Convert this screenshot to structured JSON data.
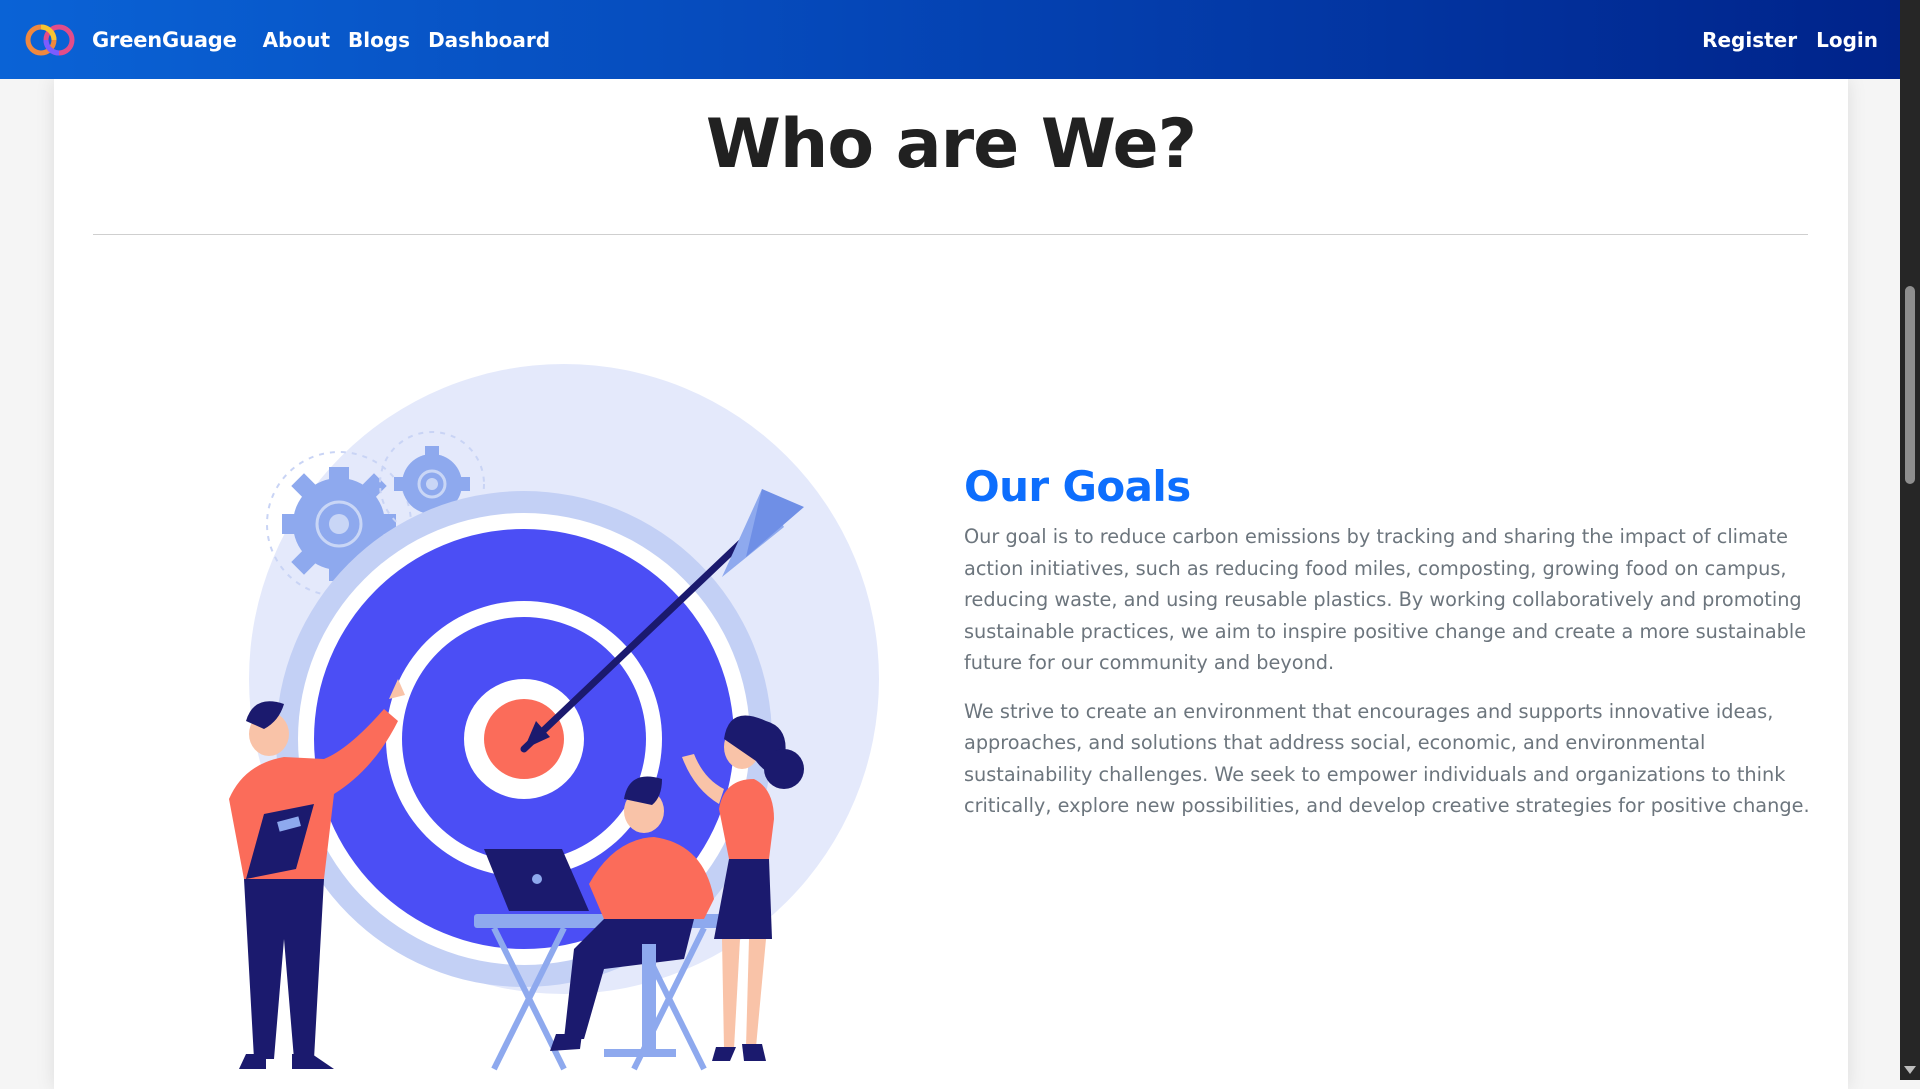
{
  "navbar": {
    "brand_name": "GreenGuage",
    "links": [
      "About",
      "Blogs",
      "Dashboard"
    ],
    "right_links": [
      "Register",
      "Login"
    ],
    "gradient_colors": [
      "#0a63d6",
      "#00238a"
    ]
  },
  "main": {
    "title": "Who are We?",
    "goals": {
      "heading": "Our Goals",
      "paragraphs": [
        "Our goal is to reduce carbon emissions by tracking and sharing the impact of climate action initiatives, such as reducing food miles, composting, growing food on campus, reducing waste, and using reusable plastics. By working collaboratively and promoting sustainable practices, we aim to inspire positive change and create a more sustainable future for our community and beyond.",
        "We strive to create an environment that encourages and supports innovative ideas, approaches, and solutions that address social, economic, and environmental sustainability challenges. We seek to empower individuals and organizations to think critically, explore new possibilities, and develop creative strategies for positive change."
      ]
    },
    "illustration_icon": "target-team-illustration",
    "colors": {
      "heading_accent": "#0d6efd",
      "target_blue": "#4b4ef5",
      "accent_coral": "#fb6c5a",
      "dark_navy": "#1b1a6e"
    }
  },
  "icons": {
    "logo": "rings-logo-icon",
    "gears": "gear-icon",
    "scroll_down": "chevron-down-icon"
  }
}
